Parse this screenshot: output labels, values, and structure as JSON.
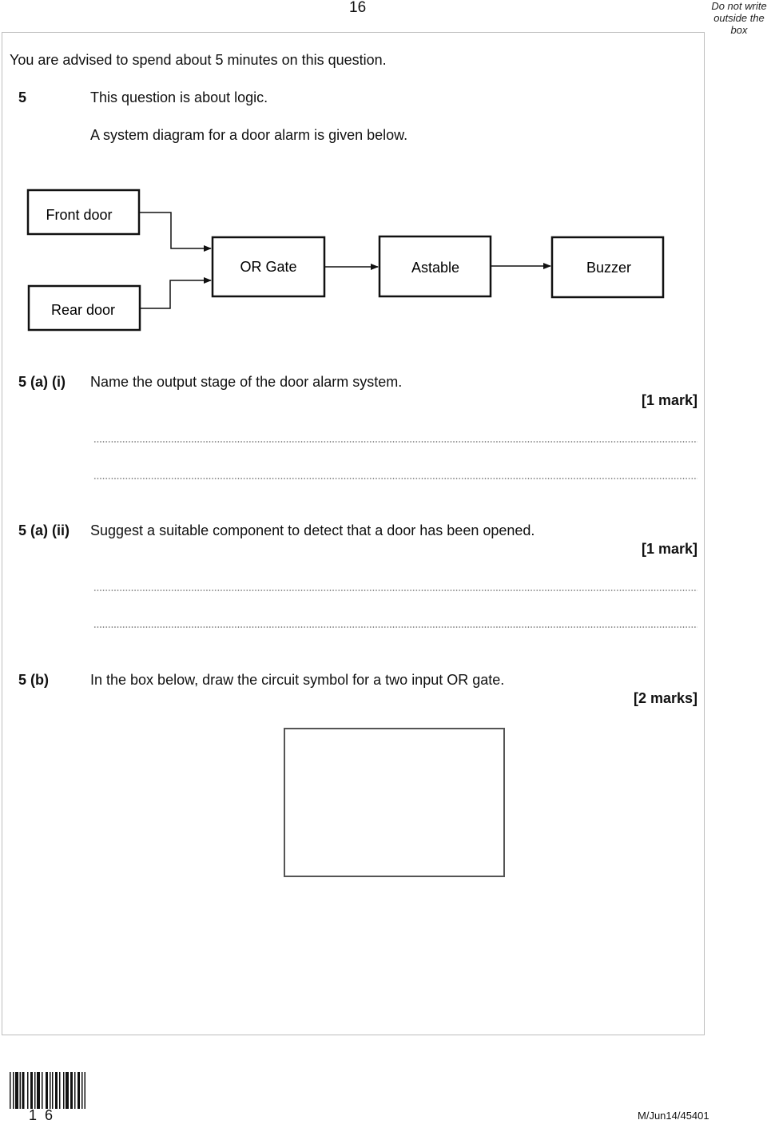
{
  "header": {
    "page_number": "16",
    "margin_note": [
      "Do not write",
      "outside the",
      "box"
    ]
  },
  "intro": {
    "advice": "You are advised to spend about 5 minutes on this question."
  },
  "question": {
    "number": "5",
    "topic": "This question is about logic.",
    "diagram_intro": "A system diagram for a door alarm is given below."
  },
  "diagram": {
    "blocks": {
      "front_door": "Front door",
      "rear_door": "Rear door",
      "or_gate": "OR Gate",
      "astable": "Astable",
      "buzzer": "Buzzer"
    }
  },
  "parts": [
    {
      "label": "5  (a) (i)",
      "text": "Name the output stage of the door alarm system.",
      "marks": "[1 mark]",
      "answer_lines": 2
    },
    {
      "label": "5  (a) (ii)",
      "text": "Suggest a suitable component to detect that a door has been opened.",
      "marks": "[1 mark]",
      "answer_lines": 2
    },
    {
      "label": "5  (b)",
      "text": "In the box below, draw the circuit symbol for a two input OR gate.",
      "marks": "[2 marks]"
    }
  ],
  "footer": {
    "barcode_digits": "16",
    "reference": "M/Jun14/45401"
  }
}
